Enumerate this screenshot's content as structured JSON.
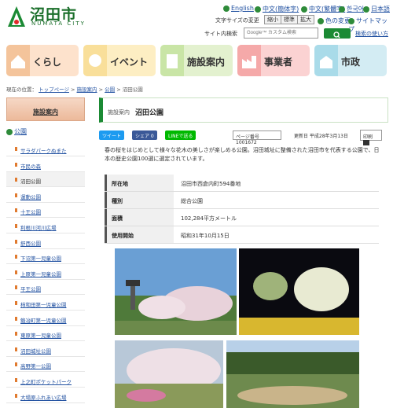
{
  "header": {
    "logo_text": "沼田市",
    "logo_sub": "NUMATA CITY",
    "languages": [
      "English",
      "中文(簡体字)",
      "中文(繁體字)",
      "한국어",
      "日本語"
    ],
    "font_size_label": "文字サイズの変更",
    "font_sizes": [
      "縮小",
      "標準",
      "拡大"
    ],
    "color_change": "色の変更",
    "sitemap": "サイトマップ",
    "search_label": "サイト内検索",
    "search_placeholder": "Google™ カスタム検索",
    "search_help": "検索の使い方"
  },
  "nav": [
    {
      "label": "くらし",
      "color": "#f4c49b"
    },
    {
      "label": "イベント",
      "color": "#f9df9a"
    },
    {
      "label": "施設案内",
      "color": "#c9e5a6"
    },
    {
      "label": "事業者",
      "color": "#f5a9a9"
    },
    {
      "label": "市政",
      "color": "#a9dbe9"
    }
  ],
  "breadcrumb": {
    "label": "現在の位置：",
    "items": [
      "トップページ",
      "施設案内",
      "公園",
      "沼田公園"
    ]
  },
  "sidebar": {
    "heading": "施設案内",
    "top": "公園",
    "items": [
      "サラダパークぬまた",
      "市民の森",
      "沼田公園",
      "運動公園",
      "十王公園",
      "利根川河川広場",
      "舒西公園",
      "下沼第一児童公園",
      "上原第一児童公園",
      "平王公園",
      "柿和田第一児童公園",
      "鍛冶町第一児童公園",
      "東原第一児童公園",
      "沼田城址公園",
      "高野第一公園",
      "上之町ポケットパーク",
      "大場原ふれあい広場"
    ],
    "current": 2
  },
  "main": {
    "category": "施設案内",
    "title": "沼田公園",
    "tweet": "ツイート",
    "share": "シェア 0",
    "line": "LINEで送る",
    "page_no": "ページ番号1001672",
    "updated": "更新日 平成28年3月13日",
    "print": "印刷",
    "intro": "春の桜をはじめとして様々な花木の美しさが楽しめる公園。沼田城址に整備された沼田市を代表する公園で、日本の歴史公園100選に選定されています。",
    "info": [
      {
        "k": "所在地",
        "v": "沼田市西倉内町594番地"
      },
      {
        "k": "種別",
        "v": "総合公園"
      },
      {
        "k": "面積",
        "v": "102,284平方メートル"
      },
      {
        "k": "使用開始",
        "v": "昭和31年10月15日"
      }
    ]
  }
}
